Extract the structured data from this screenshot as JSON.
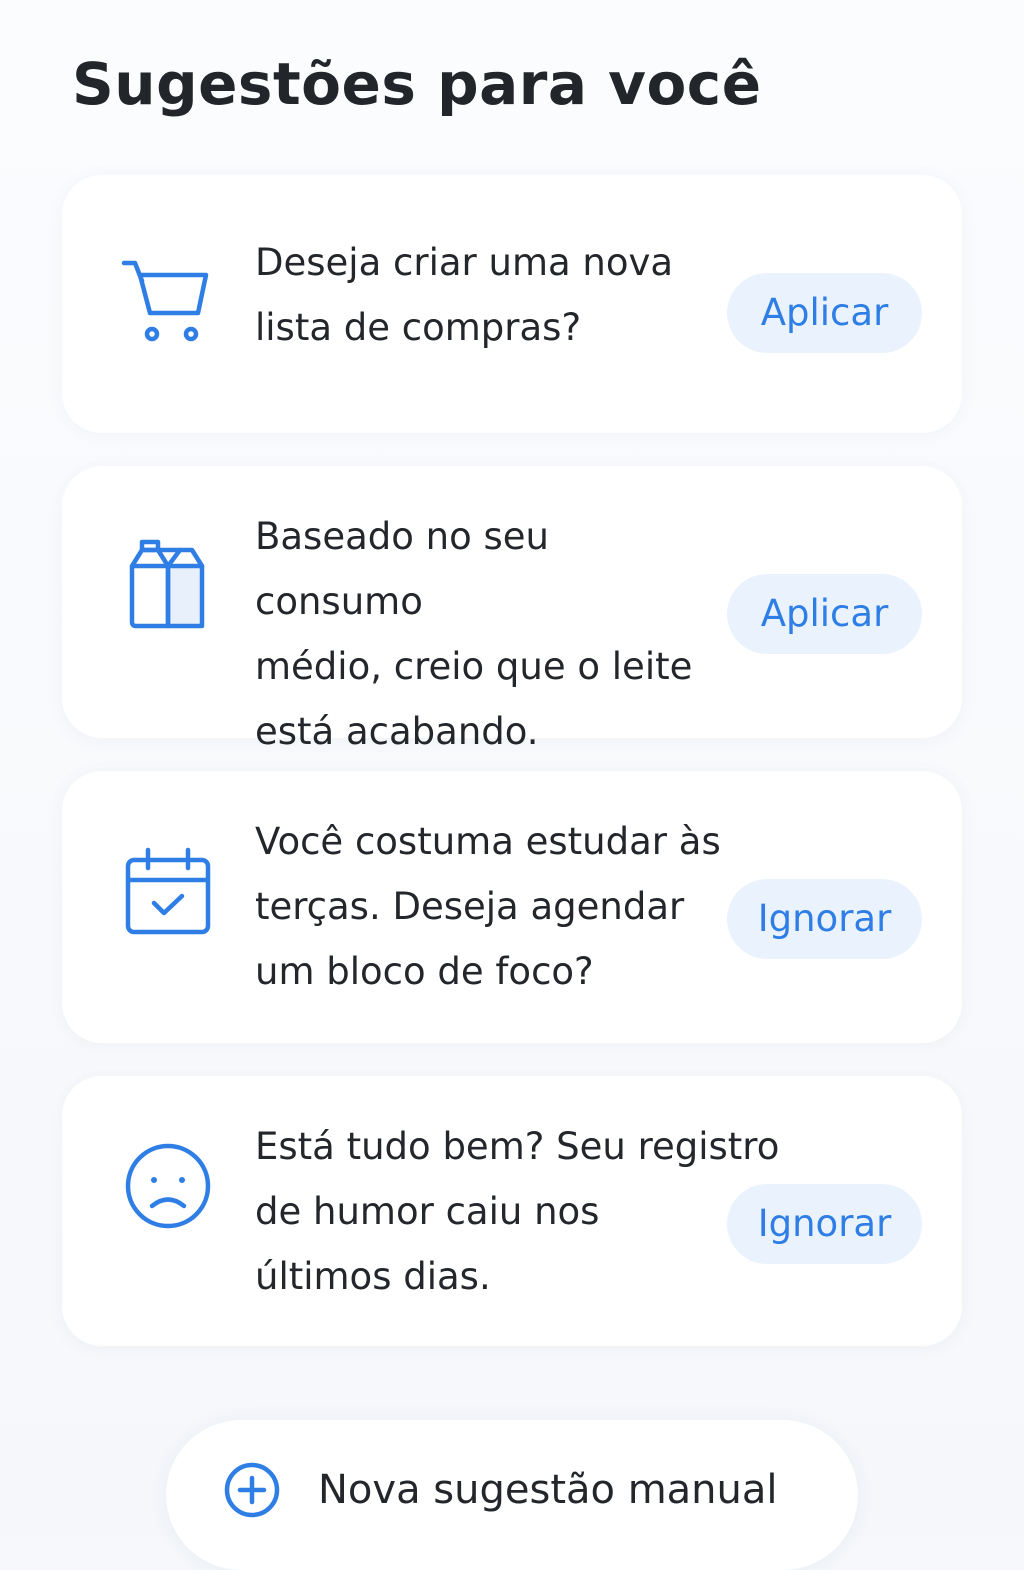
{
  "page": {
    "title": "Sugestões para você"
  },
  "suggestions": [
    {
      "icon": "shopping-cart-icon",
      "text": "Deseja criar uma nova\nlista de compras?",
      "action_label": "Aplicar"
    },
    {
      "icon": "milk-carton-icon",
      "text": "Baseado no seu consumo\nmédio, creio que o leite\nestá acabando.",
      "action_label": "Aplicar"
    },
    {
      "icon": "calendar-check-icon",
      "text": "Você costuma estudar às\nterças. Deseja agendar\num bloco de foco?",
      "action_label": "Ignorar"
    },
    {
      "icon": "sad-face-icon",
      "text": "Está tudo bem? Seu registro\nde humor caiu nos\núltimos dias.",
      "action_label": "Ignorar"
    }
  ],
  "footer": {
    "new_suggestion_label": "Nova sugestão manual",
    "icon": "plus-circle-icon"
  },
  "colors": {
    "accent": "#2f7ee6",
    "button_bg": "#eaf3fd",
    "card_bg": "#ffffff",
    "page_bg": "#f6f8fb",
    "text": "#23262b"
  }
}
